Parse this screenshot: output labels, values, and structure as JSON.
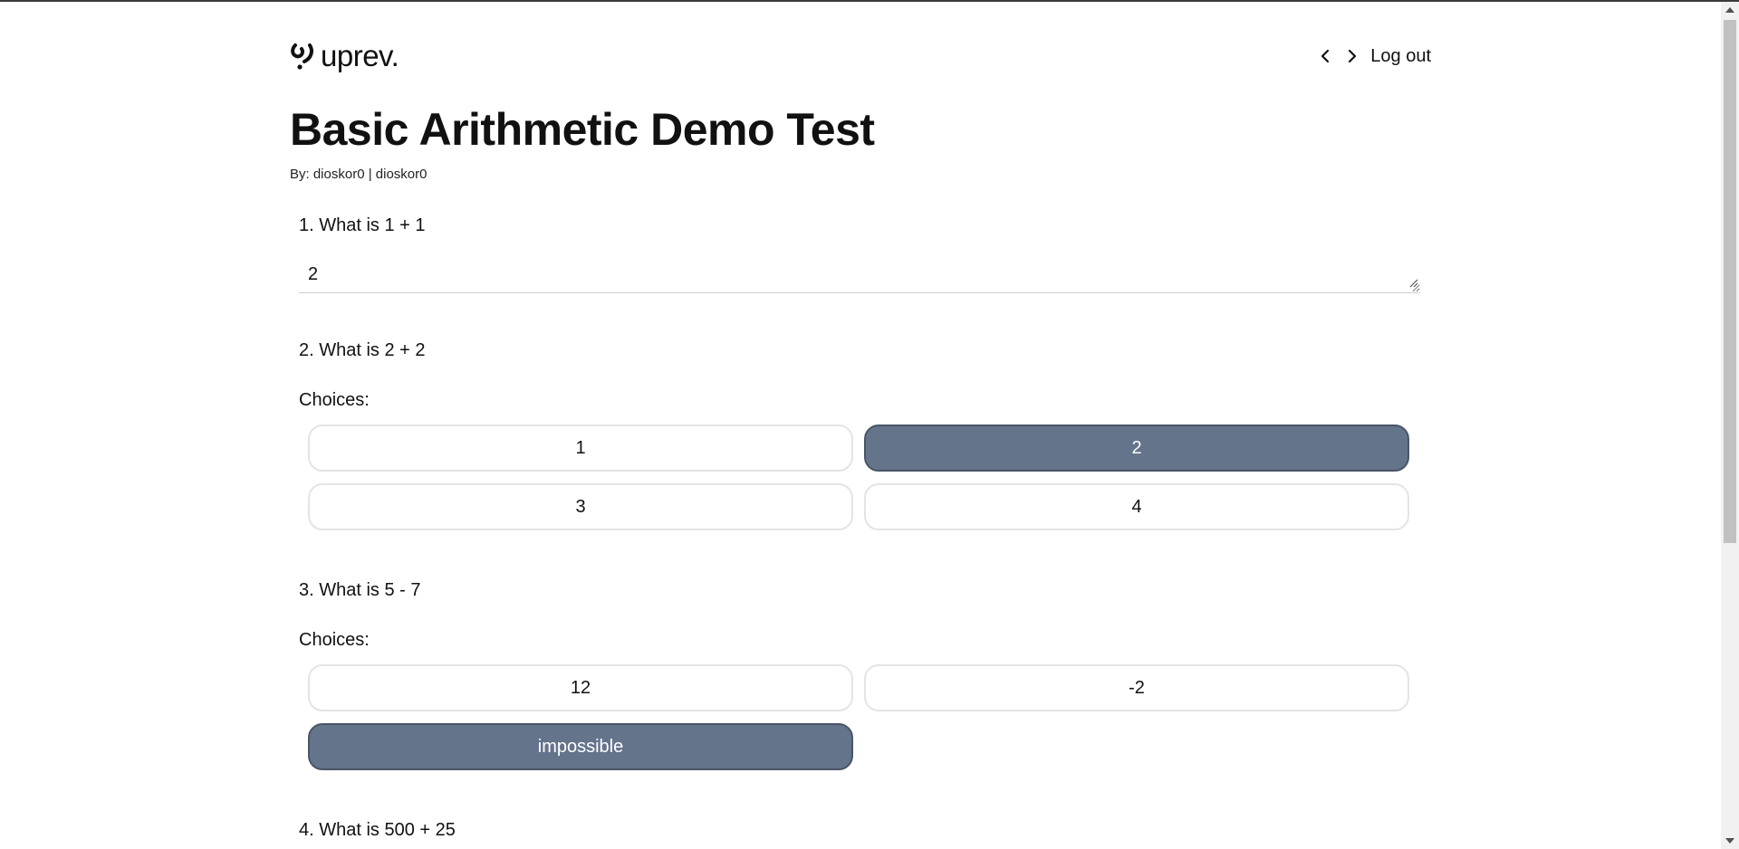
{
  "app": {
    "logo_text": "uprev.",
    "logout_label": "Log out"
  },
  "test": {
    "title": "Basic Arithmetic Demo Test",
    "byline": "By: dioskor0 | dioskor0"
  },
  "questions": [
    {
      "text": "1. What is 1 + 1",
      "answer": "2"
    },
    {
      "text": "2. What is 2 + 2",
      "choices_label": "Choices:",
      "choices": [
        "1",
        "2",
        "3",
        "4"
      ],
      "selected": "2"
    },
    {
      "text": "3. What is 5 - 7",
      "choices_label": "Choices:",
      "choices": [
        "12",
        "-2",
        "impossible"
      ],
      "selected": "impossible"
    },
    {
      "text": "4. What is 500 + 25"
    }
  ],
  "colors": {
    "selected_choice": "#64748b",
    "choice_border": "#e4e4e4"
  },
  "icons": [
    "logo-mark-icon",
    "chevron-left-icon",
    "chevron-right-icon",
    "resize-grip-icon"
  ]
}
